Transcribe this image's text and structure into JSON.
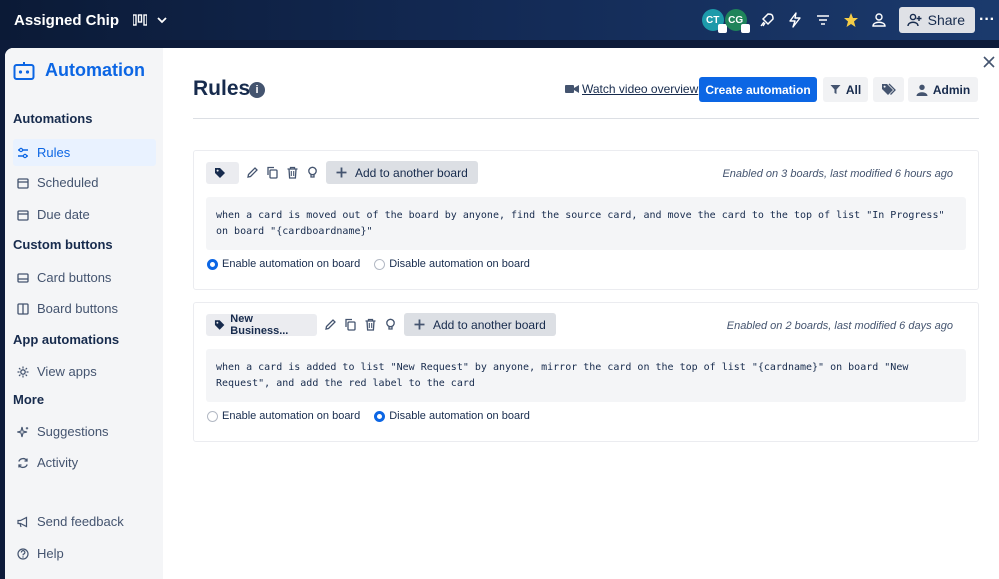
{
  "topbar": {
    "board_title": "Assigned Chip",
    "avatars": [
      {
        "initials": "CT",
        "color": "#1d9aaa"
      },
      {
        "initials": "CG",
        "color": "#1f845a"
      }
    ],
    "share_label": "Share",
    "more": "···"
  },
  "sidebar": {
    "title": "Automation",
    "sections": [
      {
        "label": "Automations"
      },
      {
        "label": "Custom buttons"
      },
      {
        "label": "App automations"
      },
      {
        "label": "More"
      }
    ],
    "items": [
      {
        "label": "Rules"
      },
      {
        "label": "Scheduled"
      },
      {
        "label": "Due date"
      },
      {
        "label": "Card buttons"
      },
      {
        "label": "Board buttons"
      },
      {
        "label": "View apps"
      },
      {
        "label": "Suggestions"
      },
      {
        "label": "Activity"
      },
      {
        "label": "Send feedback"
      },
      {
        "label": "Help"
      }
    ]
  },
  "main": {
    "title": "Rules",
    "info": "i",
    "video_link": "Watch video overview",
    "create_button": "Create automation",
    "filter_label": "All",
    "admin_label": "Admin",
    "rules": [
      {
        "label_chip": "",
        "add_board": "Add to another board",
        "meta": "Enabled on 3 boards, last modified 6 hours ago",
        "text": "when a card is moved out of the board by anyone, find the source card, and move the card to the top of list \"In Progress\" on board \"{cardboardname}\"",
        "enable_label": "Enable automation on board",
        "disable_label": "Disable automation on board",
        "enabled": true
      },
      {
        "label_chip": "New Business...",
        "add_board": "Add to another board",
        "meta": "Enabled on 2 boards, last modified 6 days ago",
        "text": "when a card is added to list \"New Request\" by anyone, mirror the card on the top of list \"{cardname}\" on board \"New Request\", and add the red label to the card",
        "enable_label": "Enable automation on board",
        "disable_label": "Disable automation on board",
        "enabled": false
      }
    ]
  },
  "colors": {
    "accent": "#0c66e4",
    "sidebar_bg": "#f4f5f7",
    "topbar_bg": "#0b1a36"
  }
}
